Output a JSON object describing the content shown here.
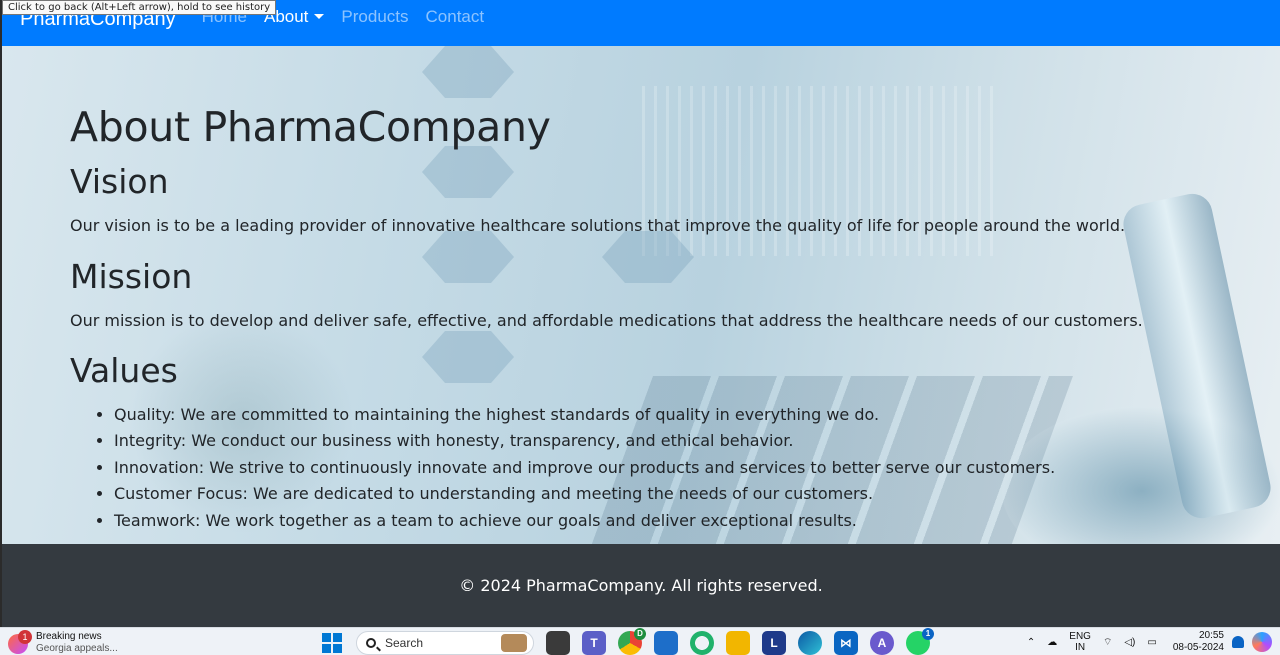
{
  "tooltip": "Click to go back (Alt+Left arrow), hold to see history",
  "navbar": {
    "brand": "PharmaCompany",
    "links": [
      {
        "label": "Home",
        "active": false
      },
      {
        "label": "About",
        "active": true,
        "dropdown": true
      },
      {
        "label": "Products",
        "active": false
      },
      {
        "label": "Contact",
        "active": false
      }
    ]
  },
  "main": {
    "title": "About PharmaCompany",
    "vision_heading": "Vision",
    "vision_text": "Our vision is to be a leading provider of innovative healthcare solutions that improve the quality of life for people around the world.",
    "mission_heading": "Mission",
    "mission_text": "Our mission is to develop and deliver safe, effective, and affordable medications that address the healthcare needs of our customers.",
    "values_heading": "Values",
    "values": [
      "Quality: We are committed to maintaining the highest standards of quality in everything we do.",
      "Integrity: We conduct our business with honesty, transparency, and ethical behavior.",
      "Innovation: We strive to continuously innovate and improve our products and services to better serve our customers.",
      "Customer Focus: We are dedicated to understanding and meeting the needs of our customers.",
      "Teamwork: We work together as a team to achieve our goals and deliver exceptional results."
    ]
  },
  "footer": {
    "text": "© 2024 PharmaCompany. All rights reserved."
  },
  "taskbar": {
    "news_title": "Breaking news",
    "news_sub": "Georgia appeals...",
    "news_badge": "1",
    "search_label": "Search",
    "apps": [
      "task-view",
      "teams",
      "chrome",
      "store",
      "copilot-app",
      "file-explorer",
      "l-app",
      "edge",
      "vscode",
      "arc-app",
      "whatsapp"
    ],
    "chrome_badge": "D",
    "whatsapp_badge": "1",
    "lang_top": "ENG",
    "lang_bottom": "IN",
    "time": "20:55",
    "date": "08-05-2024"
  },
  "colors": {
    "navbar": "#007bff",
    "footer": "#343a40",
    "text": "#212529"
  }
}
